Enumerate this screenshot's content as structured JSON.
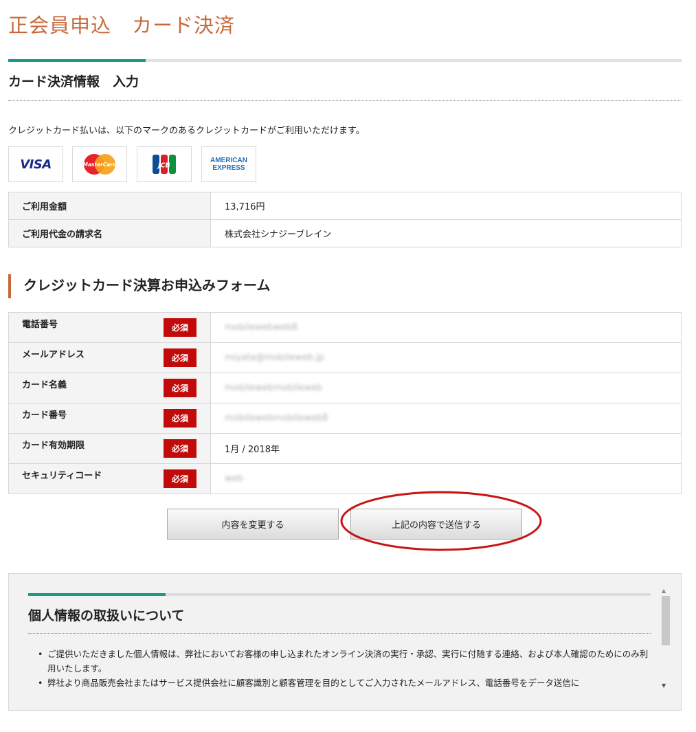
{
  "header": {
    "title": "正会員申込　カード決済"
  },
  "section": {
    "title": "カード決済情報　入力",
    "card_note": "クレジットカード払いは、以下のマークのあるクレジットカードがご利用いただけます。"
  },
  "brands": {
    "visa": "VISA",
    "mastercard": "MasterCard",
    "jcb": "JCB",
    "amex_line1": "AMERICAN",
    "amex_line2": "EXPRESS"
  },
  "billing": {
    "rows": [
      {
        "label": "ご利用金額",
        "value": "13,716円"
      },
      {
        "label": "ご利用代金の請求名",
        "value": "株式会社シナジーブレイン"
      }
    ]
  },
  "form": {
    "title": "クレジットカード決算お申込みフォーム",
    "required_badge": "必須",
    "rows": [
      {
        "label": "電話番号",
        "value": "mobilewebweb8"
      },
      {
        "label": "メールアドレス",
        "value": "miyata@mobileweb.jp"
      },
      {
        "label": "カード名義",
        "value": "mobilewebmobileweb"
      },
      {
        "label": "カード番号",
        "value": "mobilewebmobileweb8"
      },
      {
        "label": "カード有効期限",
        "value": "1月 / 2018年"
      },
      {
        "label": "セキュリティコード",
        "value": "web"
      }
    ]
  },
  "buttons": {
    "change": "内容を変更する",
    "submit": "上記の内容で送信する"
  },
  "privacy": {
    "title": "個人情報の取扱いについて",
    "items": [
      "ご提供いただきました個人情報は、弊社においてお客様の申し込まれたオンライン決済の実行・承認、実行に付随する連絡、および本人確認のためにのみ利用いたします。",
      "弊社より商品販売会社またはサービス提供会社に顧客識別と顧客管理を目的としてご入力されたメールアドレス、電話番号をデータ送信に"
    ]
  },
  "colors": {
    "accent_orange": "#c8683a",
    "accent_teal": "#1a9a8c",
    "required_red": "#c30a0a",
    "callout_red": "#c81414"
  }
}
